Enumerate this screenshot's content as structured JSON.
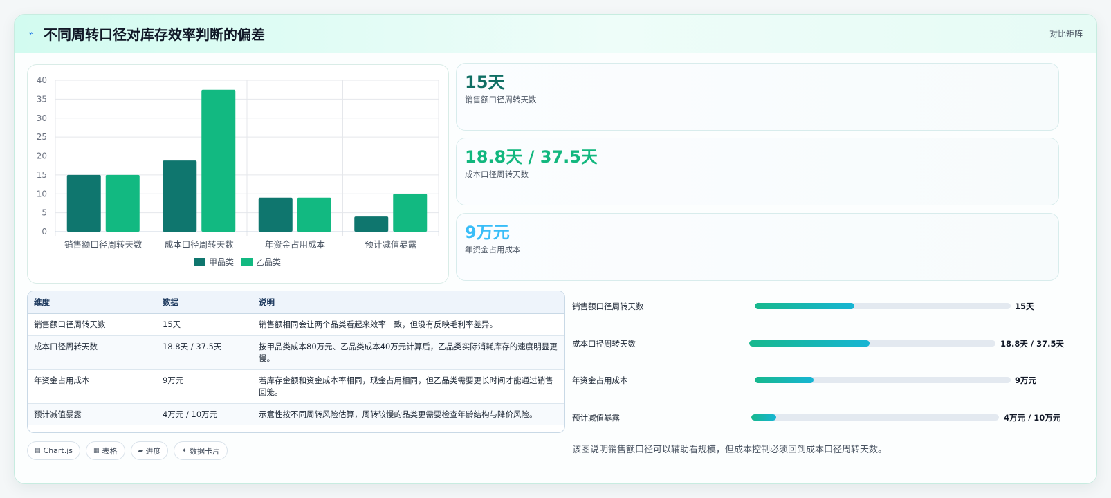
{
  "header": {
    "title": "不同周转口径对库存效率判断的偏差",
    "action": "对比矩阵",
    "icon": "bolt-icon"
  },
  "chart_data": {
    "type": "bar",
    "categories": [
      "销售额口径周转天数",
      "成本口径周转天数",
      "年资金占用成本",
      "预计减值暴露"
    ],
    "series": [
      {
        "name": "甲品类",
        "values": [
          15,
          18.8,
          9,
          4
        ],
        "color": "#0f766e"
      },
      {
        "name": "乙品类",
        "values": [
          15,
          37.5,
          9,
          10
        ],
        "color": "#12b981"
      }
    ],
    "ylim": [
      0,
      40
    ],
    "yticks": [
      0,
      5,
      10,
      15,
      20,
      25,
      30,
      35,
      40
    ],
    "grid": true,
    "legend": "bottom"
  },
  "stats": [
    {
      "value": "15天",
      "label": "销售额口径周转天数",
      "color": "#0f6e63"
    },
    {
      "value": "18.8天 / 37.5天",
      "label": "成本口径周转天数",
      "color": "#12b77e"
    },
    {
      "value": "9万元",
      "label": "年资金占用成本",
      "color": "#38bdf8"
    }
  ],
  "table": {
    "headers": [
      "维度",
      "数据",
      "说明"
    ],
    "rows": [
      [
        "销售额口径周转天数",
        "15天",
        "销售额相同会让两个品类看起来效率一致，但没有反映毛利率差异。"
      ],
      [
        "成本口径周转天数",
        "18.8天 / 37.5天",
        "按甲品类成本80万元、乙品类成本40万元计算后，乙品类实际消耗库存的速度明显更慢。"
      ],
      [
        "年资金占用成本",
        "9万元",
        "若库存金额和资金成本率相同，现金占用相同，但乙品类需要更长时间才能通过销售回笼。"
      ],
      [
        "预计减值暴露",
        "4万元 / 10万元",
        "示意性按不同周转风险估算，周转较慢的品类更需要检查年龄结构与降价风险。"
      ]
    ]
  },
  "tags": [
    {
      "icon": "chart-icon",
      "glyph": "▤",
      "label": "Chart.js"
    },
    {
      "icon": "table-icon",
      "glyph": "▦",
      "label": "表格"
    },
    {
      "icon": "progress-icon",
      "glyph": "▰",
      "label": "进度"
    },
    {
      "icon": "sparkle-icon",
      "glyph": "✦",
      "label": "数据卡片"
    }
  ],
  "progress": [
    {
      "label": "销售额口径周转天数",
      "value": "15天",
      "fraction": 0.39
    },
    {
      "label": "成本口径周转天数",
      "value": "18.8天 / 37.5天",
      "fraction": 0.49
    },
    {
      "label": "年资金占用成本",
      "value": "9万元",
      "fraction": 0.23
    },
    {
      "label": "预计减值暴露",
      "value": "4万元 / 10万元",
      "fraction": 0.1
    }
  ],
  "note": "该图说明销售额口径可以辅助看规模，但成本控制必须回到成本口径周转天数。"
}
